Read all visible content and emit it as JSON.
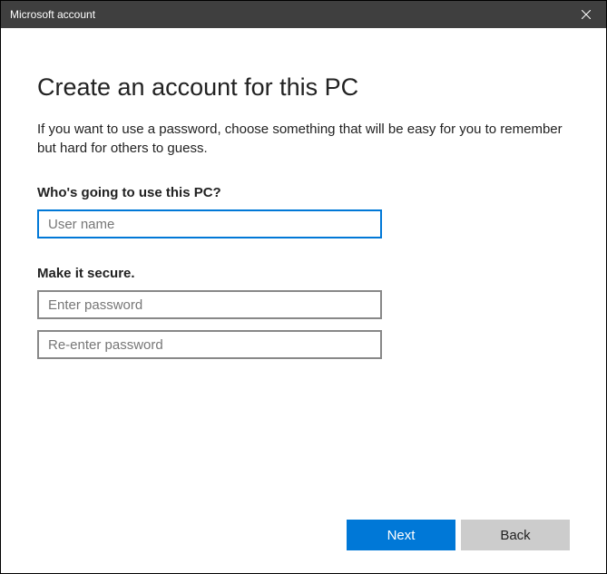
{
  "titlebar": {
    "title": "Microsoft account"
  },
  "main": {
    "heading": "Create an account for this PC",
    "description": "If you want to use a password, choose something that will be easy for you to remember but hard for others to guess.",
    "username_section": {
      "label": "Who's going to use this PC?",
      "placeholder": "User name",
      "value": ""
    },
    "password_section": {
      "label": "Make it secure.",
      "password_placeholder": "Enter password",
      "password_value": "",
      "confirm_placeholder": "Re-enter password",
      "confirm_value": ""
    }
  },
  "buttons": {
    "next": "Next",
    "back": "Back"
  }
}
